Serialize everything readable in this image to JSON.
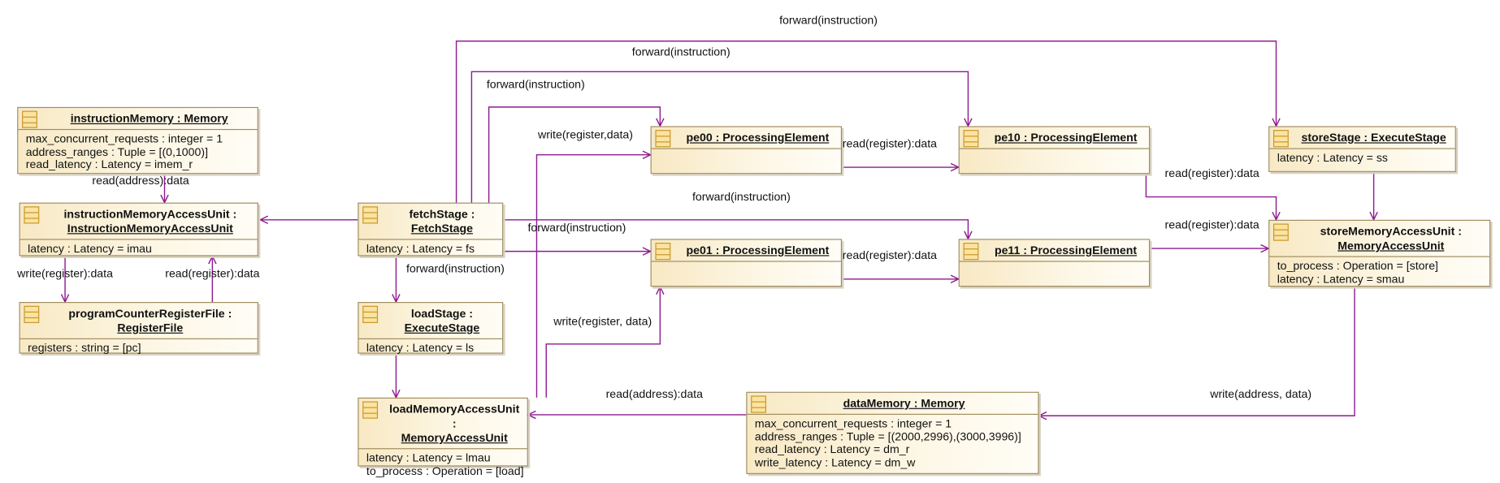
{
  "colors": {
    "edge": "#8e1a91",
    "box_border": "#a08c5e",
    "box_fill": "#f8e9c4",
    "icon": "#c8962a"
  },
  "objects": [
    {
      "id": "instructionMemory",
      "line1": "instructionMemory : Memory",
      "line2": "",
      "attrs": [
        "max_concurrent_requests : integer = 1",
        "address_ranges : Tuple = [(0,1000)]",
        "read_latency : Latency = imem_r"
      ]
    },
    {
      "id": "instructionMemoryAccessUnit",
      "line1": "instructionMemoryAccessUnit :",
      "line2": "InstructionMemoryAccessUnit",
      "attrs": [
        "latency : Latency = imau"
      ]
    },
    {
      "id": "programCounterRegisterFile",
      "line1": "programCounterRegisterFile :",
      "line2": "RegisterFile",
      "attrs": [
        "registers : string = [pc]"
      ]
    },
    {
      "id": "fetchStage",
      "line1": "fetchStage :",
      "line2": "FetchStage",
      "attrs": [
        "latency : Latency = fs"
      ]
    },
    {
      "id": "loadStage",
      "line1": "loadStage :",
      "line2": "ExecuteStage",
      "attrs": [
        "latency : Latency = ls"
      ]
    },
    {
      "id": "loadMemoryAccessUnit",
      "line1": "loadMemoryAccessUnit :",
      "line2": "MemoryAccessUnit",
      "attrs": [
        "latency : Latency = lmau",
        "to_process : Operation = [load]"
      ]
    },
    {
      "id": "pe00",
      "line1": "pe00 : ProcessingElement",
      "line2": "",
      "attrs": []
    },
    {
      "id": "pe01",
      "line1": "pe01 : ProcessingElement",
      "line2": "",
      "attrs": []
    },
    {
      "id": "pe10",
      "line1": "pe10 : ProcessingElement",
      "line2": "",
      "attrs": []
    },
    {
      "id": "pe11",
      "line1": "pe11 : ProcessingElement",
      "line2": "",
      "attrs": []
    },
    {
      "id": "storeStage",
      "line1": "storeStage : ExecuteStage",
      "line2": "",
      "attrs": [
        "latency : Latency = ss"
      ]
    },
    {
      "id": "storeMemoryAccessUnit",
      "line1": "storeMemoryAccessUnit :",
      "line2": "MemoryAccessUnit",
      "attrs": [
        "to_process : Operation = [store]",
        "latency : Latency = smau"
      ]
    },
    {
      "id": "dataMemory",
      "line1": "dataMemory : Memory",
      "line2": "",
      "attrs": [
        "max_concurrent_requests : integer = 1",
        "address_ranges : Tuple = [(2000,2996),(3000,3996)]",
        "read_latency : Latency = dm_r",
        "write_latency : Latency = dm_w"
      ]
    }
  ],
  "edges": [
    {
      "id": "e1",
      "from": "fetchStage",
      "to": "instructionMemoryAccessUnit",
      "label": ""
    },
    {
      "id": "e2",
      "from": "instructionMemory",
      "to": "instructionMemoryAccessUnit",
      "label": "read(address):data"
    },
    {
      "id": "e3",
      "from": "instructionMemoryAccessUnit",
      "to": "programCounterRegisterFile",
      "label": "write(register):data"
    },
    {
      "id": "e4",
      "from": "programCounterRegisterFile",
      "to": "instructionMemoryAccessUnit",
      "label": "read(register):data"
    },
    {
      "id": "e5",
      "from": "fetchStage",
      "to": "storeStage",
      "label": "forward(instruction)"
    },
    {
      "id": "e6",
      "from": "fetchStage",
      "to": "pe10",
      "label": "forward(instruction)"
    },
    {
      "id": "e7",
      "from": "fetchStage",
      "to": "pe00",
      "label": "forward(instruction)"
    },
    {
      "id": "e8",
      "from": "fetchStage",
      "to": "pe11",
      "label": "forward(instruction)"
    },
    {
      "id": "e9",
      "from": "fetchStage",
      "to": "pe01",
      "label": "forward(instruction)"
    },
    {
      "id": "e10",
      "from": "fetchStage",
      "to": "loadStage",
      "label": "forward(instruction)"
    },
    {
      "id": "e11",
      "from": "loadStage",
      "to": "loadMemoryAccessUnit",
      "label": ""
    },
    {
      "id": "e12",
      "from": "loadMemoryAccessUnit",
      "to": "pe00",
      "label": "write(register,data)"
    },
    {
      "id": "e13",
      "from": "loadMemoryAccessUnit",
      "to": "pe01",
      "label": "write(register, data)"
    },
    {
      "id": "e14",
      "from": "pe00",
      "to": "pe10",
      "label": "read(register):data"
    },
    {
      "id": "e15",
      "from": "pe01",
      "to": "pe11",
      "label": "read(register):data"
    },
    {
      "id": "e16",
      "from": "pe10",
      "to": "storeMemoryAccessUnit",
      "label": "read(register):data"
    },
    {
      "id": "e17",
      "from": "pe11",
      "to": "storeMemoryAccessUnit",
      "label": "read(register):data"
    },
    {
      "id": "e18",
      "from": "storeStage",
      "to": "storeMemoryAccessUnit",
      "label": ""
    },
    {
      "id": "e19",
      "from": "storeMemoryAccessUnit",
      "to": "dataMemory",
      "label": "write(address, data)"
    },
    {
      "id": "e20",
      "from": "dataMemory",
      "to": "loadMemoryAccessUnit",
      "label": "read(address):data"
    }
  ]
}
